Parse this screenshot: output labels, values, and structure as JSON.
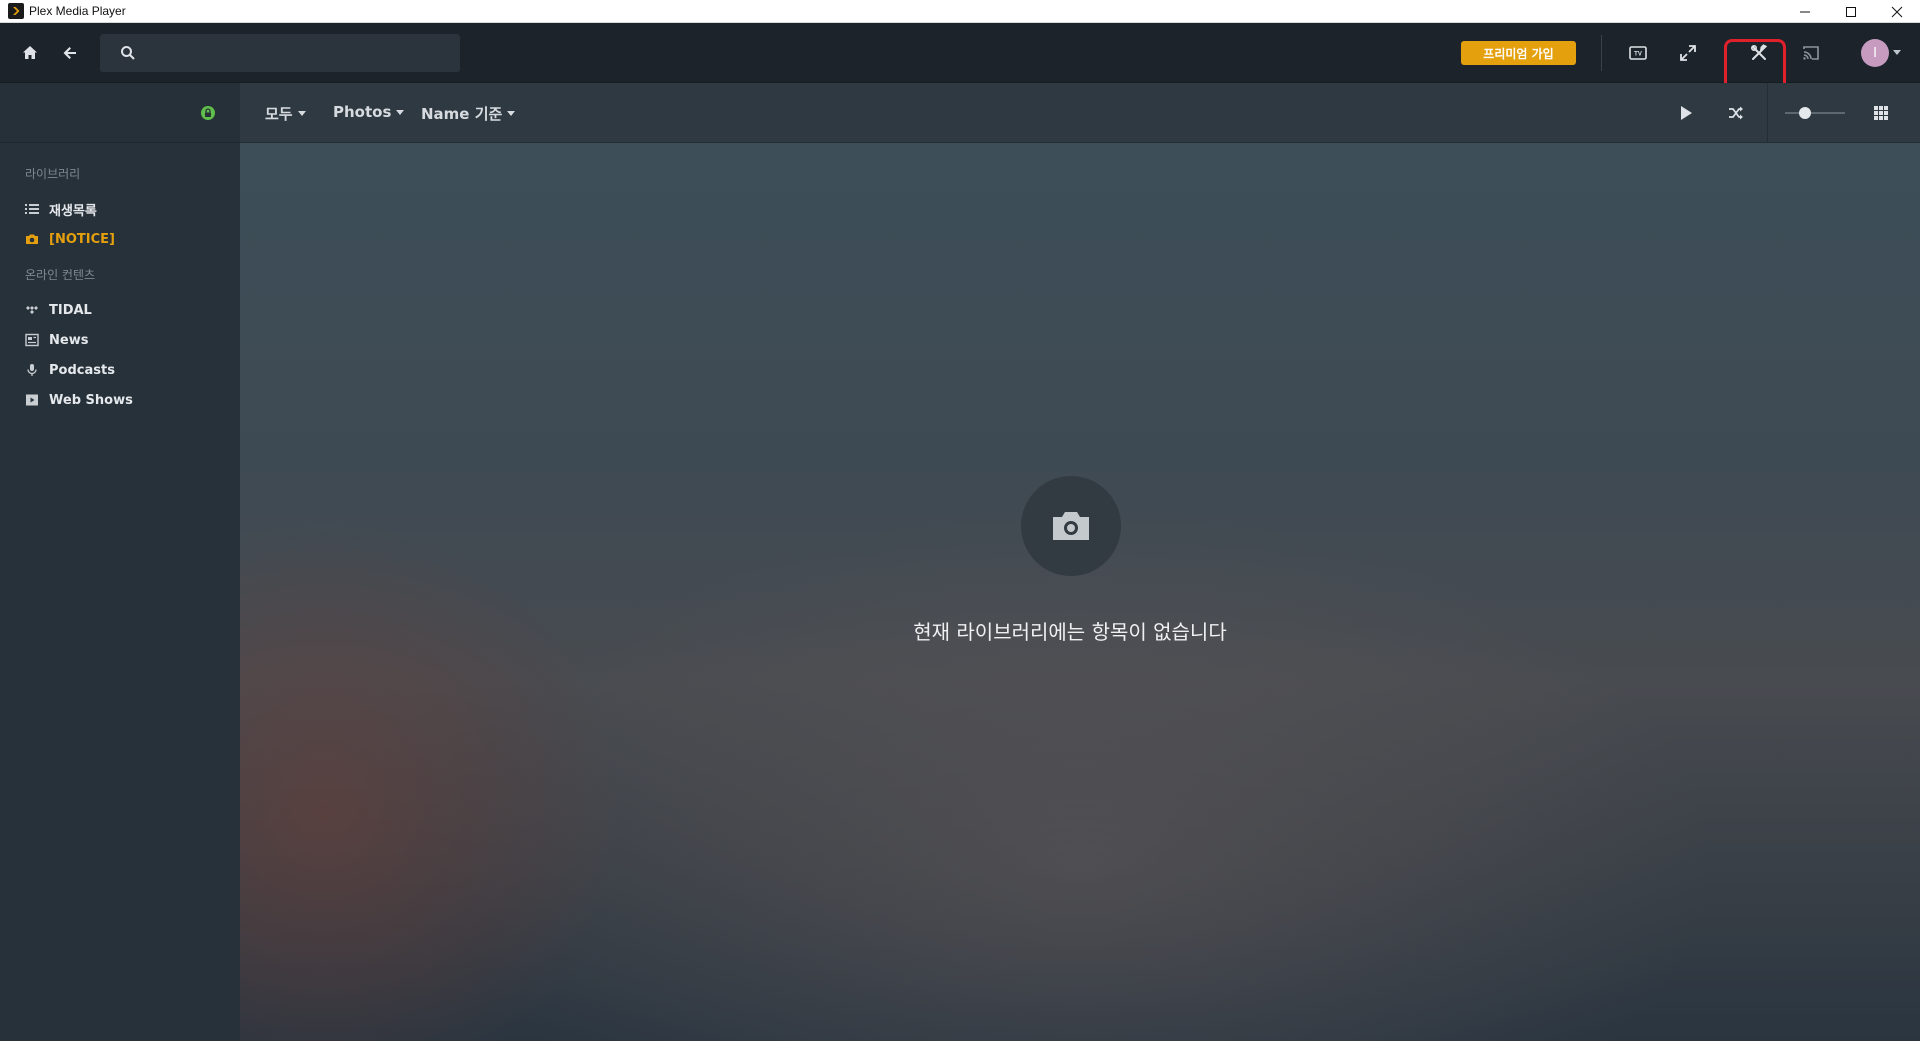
{
  "window": {
    "title": "Plex Media Player"
  },
  "topnav": {
    "search_placeholder": "",
    "premium_label": "프리미엄 가입",
    "avatar_initial": "I"
  },
  "sidebar": {
    "section_library": "라이브러리",
    "library_items": [
      {
        "label": "재생목록",
        "icon": "list-icon",
        "active": false
      },
      {
        "label": "[NOTICE]",
        "icon": "camera-icon",
        "active": true
      }
    ],
    "section_online": "온라인 컨텐츠",
    "online_items": [
      {
        "label": "TIDAL",
        "icon": "tidal-icon"
      },
      {
        "label": "News",
        "icon": "news-icon"
      },
      {
        "label": "Podcasts",
        "icon": "microphone-icon"
      },
      {
        "label": "Web Shows",
        "icon": "play-box-icon"
      }
    ]
  },
  "filterbar": {
    "filter_all": "모두",
    "filter_type": "Photos",
    "filter_sort": "Name 기준"
  },
  "main": {
    "empty_message": "현재 라이브러리에는 항목이 없습니다"
  },
  "colors": {
    "accent": "#e5a00d",
    "highlight": "#e0202a",
    "lock_green": "#5fbf4a"
  }
}
